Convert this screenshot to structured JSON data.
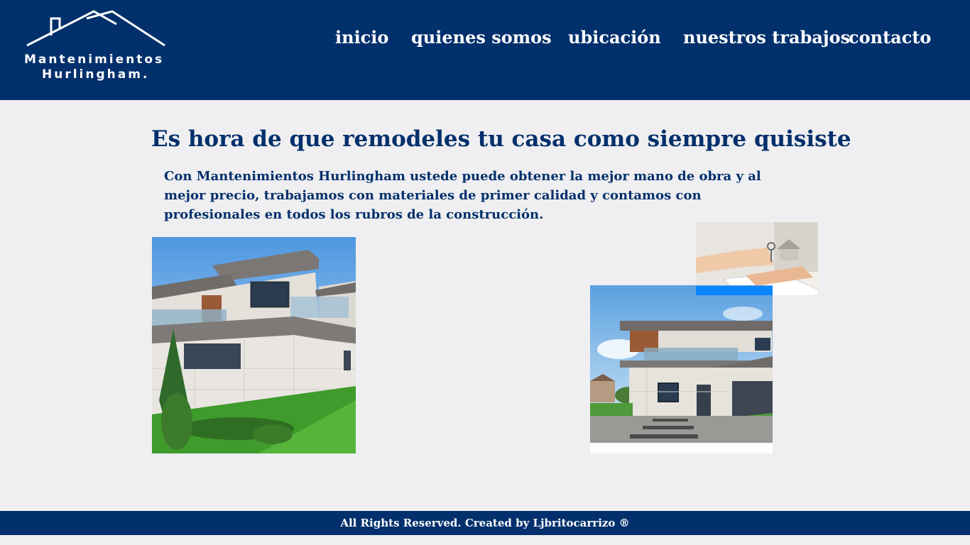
{
  "brand": {
    "name_line1": "Mantenimientos",
    "name_line2": "Hurlingham."
  },
  "nav": {
    "items": [
      {
        "label": "inicio"
      },
      {
        "label": "quienes somos"
      },
      {
        "label": "ubicación"
      },
      {
        "label": "nuestros trabajos"
      },
      {
        "label": "contacto"
      }
    ]
  },
  "main": {
    "headline": "Es hora de que remodeles tu casa como siempre quisiste",
    "intro": "Con Mantenimientos Hurlingham ustede puede obtener la mejor mano de obra y al mejor precio, trabajamos con materiales de primer calidad y contamos con profesionales en todos los rubros de la construcción."
  },
  "footer": {
    "text": "All Rights Reserved. Created by Ljbritocarrizo ®"
  },
  "colors": {
    "primary": "#01306c",
    "background": "#efeef0",
    "accent": "#0a84ff"
  }
}
